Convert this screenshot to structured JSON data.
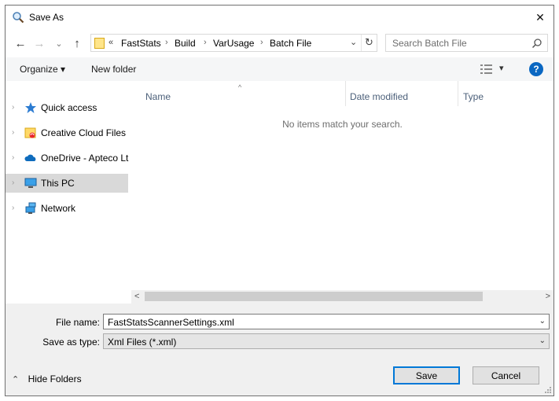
{
  "window": {
    "title": "Save As",
    "close_glyph": "✕"
  },
  "nav": {
    "back_glyph": "←",
    "forward_glyph": "→",
    "recent_glyph": "⌄",
    "up_glyph": "↑",
    "breadcrumb_overflow": "«",
    "breadcrumbs": [
      "FastStats",
      "Build",
      "VarUsage",
      "Batch File"
    ],
    "sep": "›",
    "dropdown_glyph": "⌄",
    "refresh_glyph": "↻"
  },
  "search": {
    "placeholder": "Search Batch File"
  },
  "toolbar": {
    "organize_label": "Organize ▾",
    "new_folder_label": "New folder",
    "view_arrow": "▾",
    "help_glyph": "?"
  },
  "sidebar": {
    "expander": "›",
    "items": [
      {
        "label": "Quick access",
        "icon": "star-icon"
      },
      {
        "label": "Creative Cloud Files",
        "icon": "creative-cloud-folder-icon"
      },
      {
        "label": "OneDrive - Apteco Lt",
        "icon": "onedrive-cloud-icon"
      },
      {
        "label": "This PC",
        "icon": "pc-icon",
        "selected": true
      },
      {
        "label": "Network",
        "icon": "network-icon"
      }
    ]
  },
  "files": {
    "sort_arrow": "^",
    "columns": [
      "Name",
      "Date modified",
      "Type"
    ],
    "empty_message": "No items match your search."
  },
  "scrollbar": {
    "left_glyph": "<",
    "right_glyph": ">"
  },
  "form": {
    "file_name_label": "File name:",
    "file_name_value": "FastStatsScannerSettings.xml",
    "save_type_label": "Save as type:",
    "save_type_value": "Xml Files (*.xml)",
    "dropdown_glyph": "⌄"
  },
  "footer": {
    "hide_folders_label": "Hide Folders",
    "hide_folders_glyph": "⌃",
    "save_label": "Save",
    "cancel_label": "Cancel"
  },
  "colors": {
    "accent": "#0078d7",
    "help": "#0a67c2",
    "selected": "#d9d9d9",
    "header_text": "#4c607a"
  }
}
